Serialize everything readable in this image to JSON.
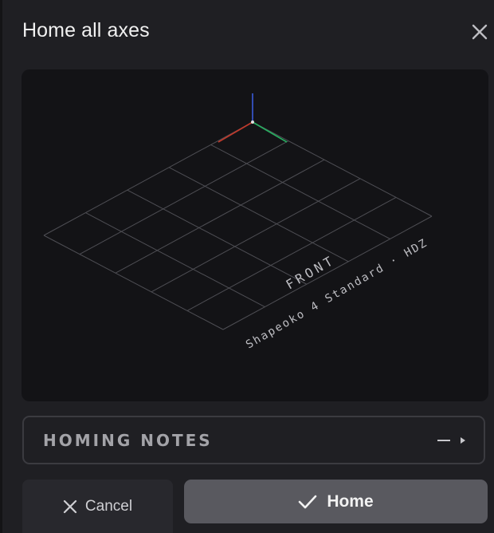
{
  "dialog": {
    "title": "Home all axes",
    "close_icon": "close-icon"
  },
  "viewport": {
    "front_label": "FRONT",
    "machine_label": "Shapeoko 4 Standard · HDZ",
    "axis_colors": {
      "x": "#c0392b",
      "y": "#27ae60",
      "z": "#3b5bdb"
    },
    "grid_color": "#5a5a60"
  },
  "notes": {
    "label": "HOMING NOTES",
    "collapse_icon": "minus-icon",
    "expand_icon": "play-arrow-icon"
  },
  "actions": {
    "cancel_label": "Cancel",
    "cancel_icon": "close-icon",
    "home_label": "Home",
    "home_icon": "check-icon"
  }
}
